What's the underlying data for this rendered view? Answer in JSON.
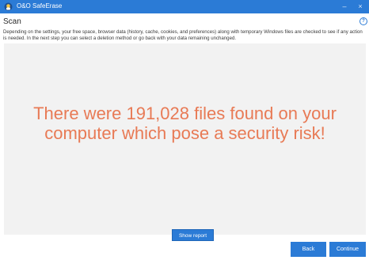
{
  "window": {
    "title": "O&O SafeErase",
    "minimize_glyph": "–",
    "close_glyph": "×"
  },
  "page": {
    "heading": "Scan",
    "description": "Depending on the settings, your free space, browser data (history, cache, cookies, and preferences) along with temporary Windows files are checked to see if any action is needed. In the next step you can select a deletion method or go back with your data remaining unchanged.",
    "result_message": "There were 191,028 files found on your computer which pose a security risk!",
    "show_report_label": "Show report"
  },
  "footer": {
    "back_label": "Back",
    "continue_label": "Continue"
  },
  "icons": {
    "info_glyph": "?"
  },
  "colors": {
    "accent": "#2b7bd6",
    "result_text": "#e87a55",
    "panel_bg": "#f2f2f2"
  }
}
